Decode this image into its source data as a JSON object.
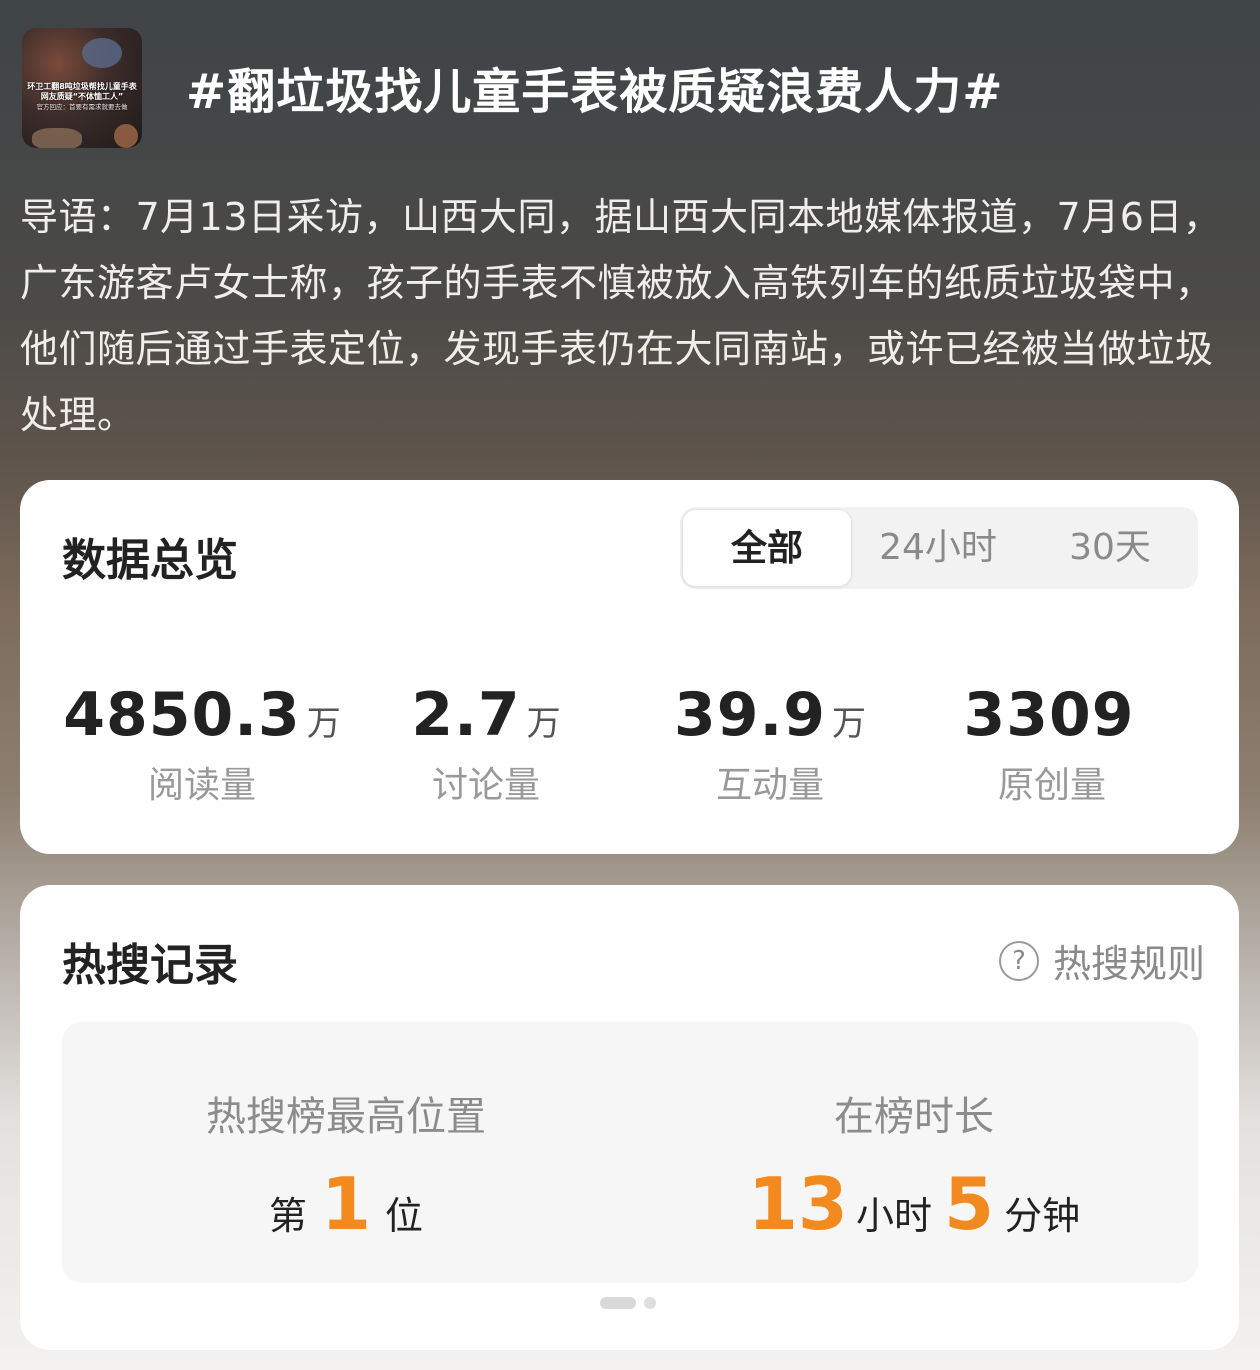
{
  "topic": {
    "title": "#翻垃圾找儿童手表被质疑浪费人力#",
    "thumbnail_caption_line1": "环卫工翻8吨垃圾帮找儿童手表",
    "thumbnail_caption_line2": "网友质疑“不体恤工人”",
    "thumbnail_caption_line3": "官方回应：首要有需求就要去做",
    "intro": "导语：7月13日采访，山西大同，据山西大同本地媒体报道，7月6日，广东游客卢女士称，孩子的手表不慎被放入高铁列车的纸质垃圾袋中，他们随后通过手表定位，发现手表仍在大同南站，或许已经被当做垃圾处理。"
  },
  "overview": {
    "title": "数据总览",
    "tabs": [
      "全部",
      "24小时",
      "30天"
    ],
    "active_tab": "全部",
    "stats": [
      {
        "value": "4850.3",
        "unit": "万",
        "label": "阅读量"
      },
      {
        "value": "2.7",
        "unit": "万",
        "label": "讨论量"
      },
      {
        "value": "39.9",
        "unit": "万",
        "label": "互动量"
      },
      {
        "value": "3309",
        "unit": "",
        "label": "原创量"
      }
    ]
  },
  "hot": {
    "title": "热搜记录",
    "rules_label": "热搜规则",
    "rules_icon": "question-circle-icon",
    "peak": {
      "label": "热搜榜最高位置",
      "prefix": "第",
      "value": "1",
      "suffix": "位"
    },
    "duration": {
      "label": "在榜时长",
      "hours": "13",
      "hours_unit": "小时",
      "minutes": "5",
      "minutes_unit": "分钟"
    }
  },
  "colors": {
    "accent_orange": "#f28a1f",
    "card_bg": "#ffffff",
    "muted_text": "#999999"
  }
}
